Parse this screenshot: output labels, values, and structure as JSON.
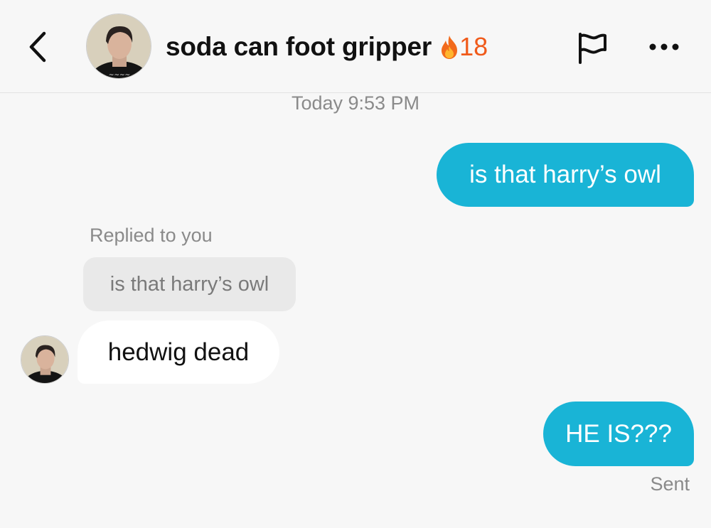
{
  "header": {
    "contact_name": "soda can foot gripper",
    "streak_count": "18",
    "icons": {
      "back": "chevron-left-icon",
      "streak": "fire-icon",
      "report": "flag-icon",
      "more": "more-horizontal-icon"
    }
  },
  "conversation": {
    "timestamp": "Today 9:53 PM",
    "messages": [
      {
        "direction": "outgoing",
        "text": "is that harry’s owl"
      },
      {
        "direction": "incoming",
        "replied_label": "Replied to you",
        "quoted_text": "is that harry’s owl",
        "text": "hedwig dead"
      },
      {
        "direction": "outgoing",
        "text": "HE IS???",
        "status": "Sent"
      }
    ]
  },
  "colors": {
    "outgoing_bubble": "#19b4d6",
    "incoming_bubble": "#ffffff",
    "quoted_bubble": "#e9e9e9",
    "streak": "#f05a1a",
    "background": "#f7f7f7"
  }
}
